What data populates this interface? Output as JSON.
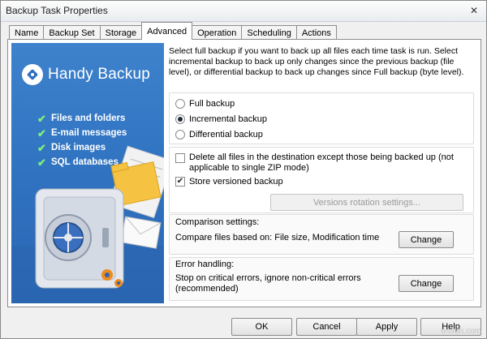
{
  "window": {
    "title": "Backup Task Properties",
    "close_glyph": "✕"
  },
  "tabs": [
    {
      "label": "Name",
      "active": false
    },
    {
      "label": "Backup Set",
      "active": false
    },
    {
      "label": "Storage",
      "active": false
    },
    {
      "label": "Advanced",
      "active": true
    },
    {
      "label": "Operation",
      "active": false
    },
    {
      "label": "Scheduling",
      "active": false
    },
    {
      "label": "Actions",
      "active": false
    }
  ],
  "banner": {
    "brand": "Handy Backup",
    "features": [
      "Files and folders",
      "E-mail messages",
      "Disk images",
      "SQL databases"
    ],
    "check_glyph": "✔",
    "bg_color": "#3174c2"
  },
  "advanced": {
    "description": "Select full backup if you want to back up all files each time task is run. Select incremental backup to back up only changes since the previous backup (file level), or differential backup to back up changes since Full backup (byte level).",
    "backup_types": [
      {
        "label": "Full backup",
        "selected": false
      },
      {
        "label": "Incremental backup",
        "selected": true
      },
      {
        "label": "Differential backup",
        "selected": false
      }
    ],
    "delete_files": {
      "label_line1": "Delete all files in the destination except those being backed up (not",
      "label_line2": "applicable to single ZIP mode)",
      "checked": false
    },
    "versioned": {
      "label": "Store versioned backup",
      "checked": true,
      "check_glyph": "✔"
    },
    "versions_rotation_button": "Versions rotation settings...",
    "comparison": {
      "title": "Comparison settings:",
      "text": "Compare files based on: File size, Modification time",
      "button": "Change"
    },
    "error_handling": {
      "title": "Error handling:",
      "text_line1": "Stop on critical errors, ignore non-critical errors",
      "text_line2": "(recommended)",
      "button": "Change"
    }
  },
  "footer": {
    "ok": "OK",
    "cancel": "Cancel",
    "apply": "Apply",
    "help": "Help"
  },
  "watermark": "wsxdn.com"
}
